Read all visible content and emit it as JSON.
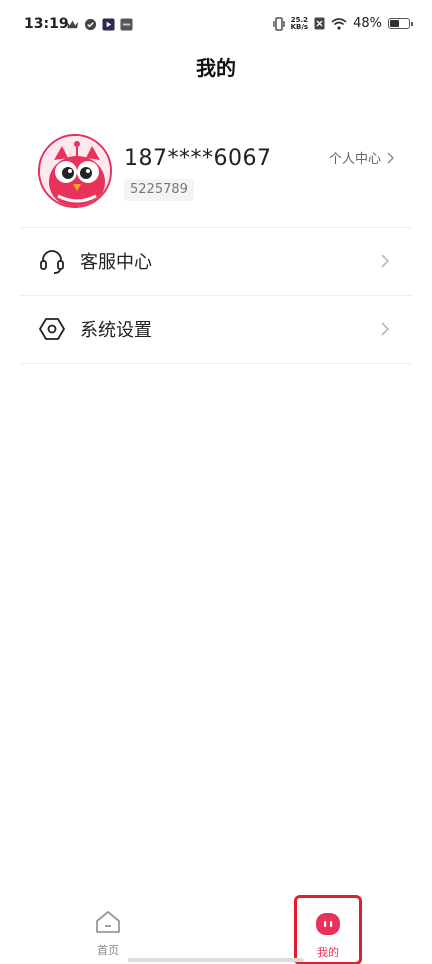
{
  "status_bar": {
    "time": "13:19",
    "speed_top": "25.2",
    "speed_bottom": "KB/s",
    "battery": "48%",
    "icons": [
      "crown-icon",
      "check-badge-icon",
      "play-app-icon",
      "app-icon",
      "vibrate-icon",
      "sim-off-icon",
      "wifi-icon",
      "battery-icon"
    ]
  },
  "header": {
    "title": "我的"
  },
  "profile": {
    "phone": "187****6067",
    "uid": "5225789",
    "personal_center_label": "个人中心",
    "accent_color": "#e8315b"
  },
  "menu": {
    "items": [
      {
        "label": "客服中心",
        "icon": "headset-icon"
      },
      {
        "label": "系统设置",
        "icon": "settings-hexagon-icon"
      }
    ]
  },
  "tab_bar": {
    "tabs": [
      {
        "label": "首页",
        "icon": "home-icon",
        "active": false
      },
      {
        "label": "我的",
        "icon": "mine-icon",
        "active": true
      }
    ],
    "active_color": "#e8315b",
    "inactive_color": "#888888"
  }
}
